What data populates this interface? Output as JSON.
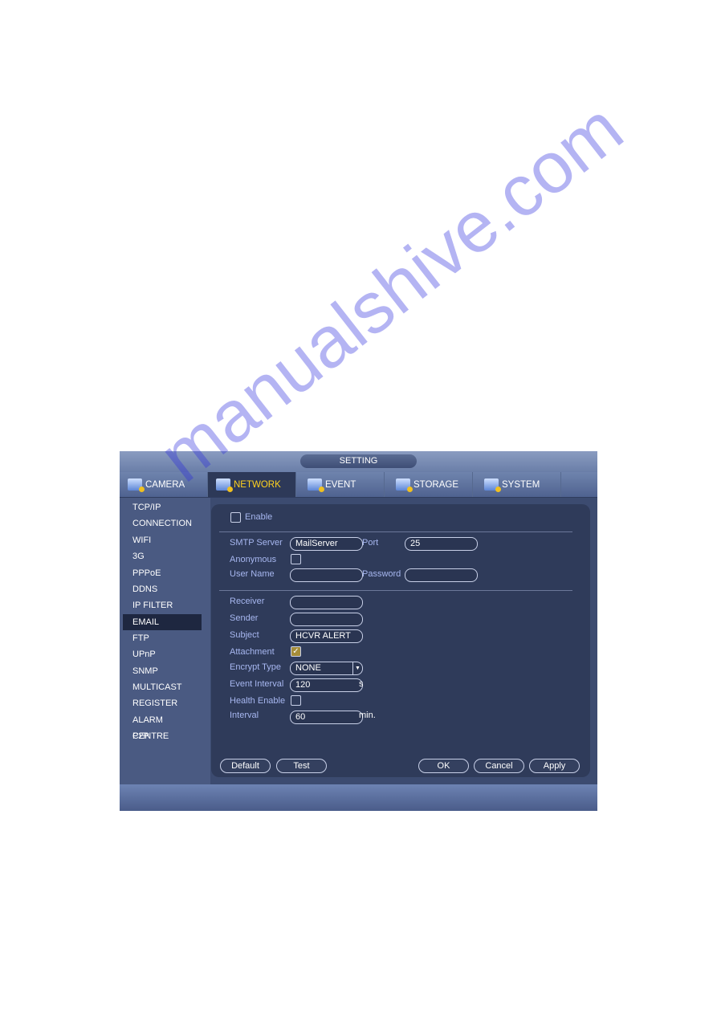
{
  "window": {
    "title": "SETTING"
  },
  "tabs": [
    {
      "label": "CAMERA",
      "icon": "camera-icon"
    },
    {
      "label": "NETWORK",
      "icon": "network-icon",
      "active": true
    },
    {
      "label": "EVENT",
      "icon": "event-icon"
    },
    {
      "label": "STORAGE",
      "icon": "storage-icon"
    },
    {
      "label": "SYSTEM",
      "icon": "system-icon"
    }
  ],
  "sidebar": {
    "items": [
      "TCP/IP",
      "CONNECTION",
      "WIFI",
      "3G",
      "PPPoE",
      "DDNS",
      "IP FILTER",
      "EMAIL",
      "FTP",
      "UPnP",
      "SNMP",
      "MULTICAST",
      "REGISTER",
      "ALARM CENTRE",
      "P2P"
    ],
    "active": "EMAIL"
  },
  "form": {
    "enable": {
      "label": "Enable",
      "checked": false
    },
    "smtp_server": {
      "label": "SMTP Server",
      "value": "MailServer"
    },
    "port": {
      "label": "Port",
      "value": "25"
    },
    "anonymous": {
      "label": "Anonymous",
      "checked": false
    },
    "user_name": {
      "label": "User Name",
      "value": ""
    },
    "password": {
      "label": "Password",
      "value": ""
    },
    "receiver": {
      "label": "Receiver",
      "value": ""
    },
    "sender": {
      "label": "Sender",
      "value": ""
    },
    "subject": {
      "label": "Subject",
      "value": "HCVR ALERT"
    },
    "attachment": {
      "label": "Attachment",
      "checked": true
    },
    "encrypt_type": {
      "label": "Encrypt Type",
      "value": "NONE"
    },
    "event_interval": {
      "label": "Event Interval",
      "value": "120",
      "unit": "s"
    },
    "health_enable": {
      "label": "Health Enable",
      "checked": false
    },
    "interval": {
      "label": "Interval",
      "value": "60",
      "unit": "min."
    }
  },
  "buttons": {
    "default": "Default",
    "test": "Test",
    "ok": "OK",
    "cancel": "Cancel",
    "apply": "Apply"
  },
  "watermark": "manualshive.com"
}
